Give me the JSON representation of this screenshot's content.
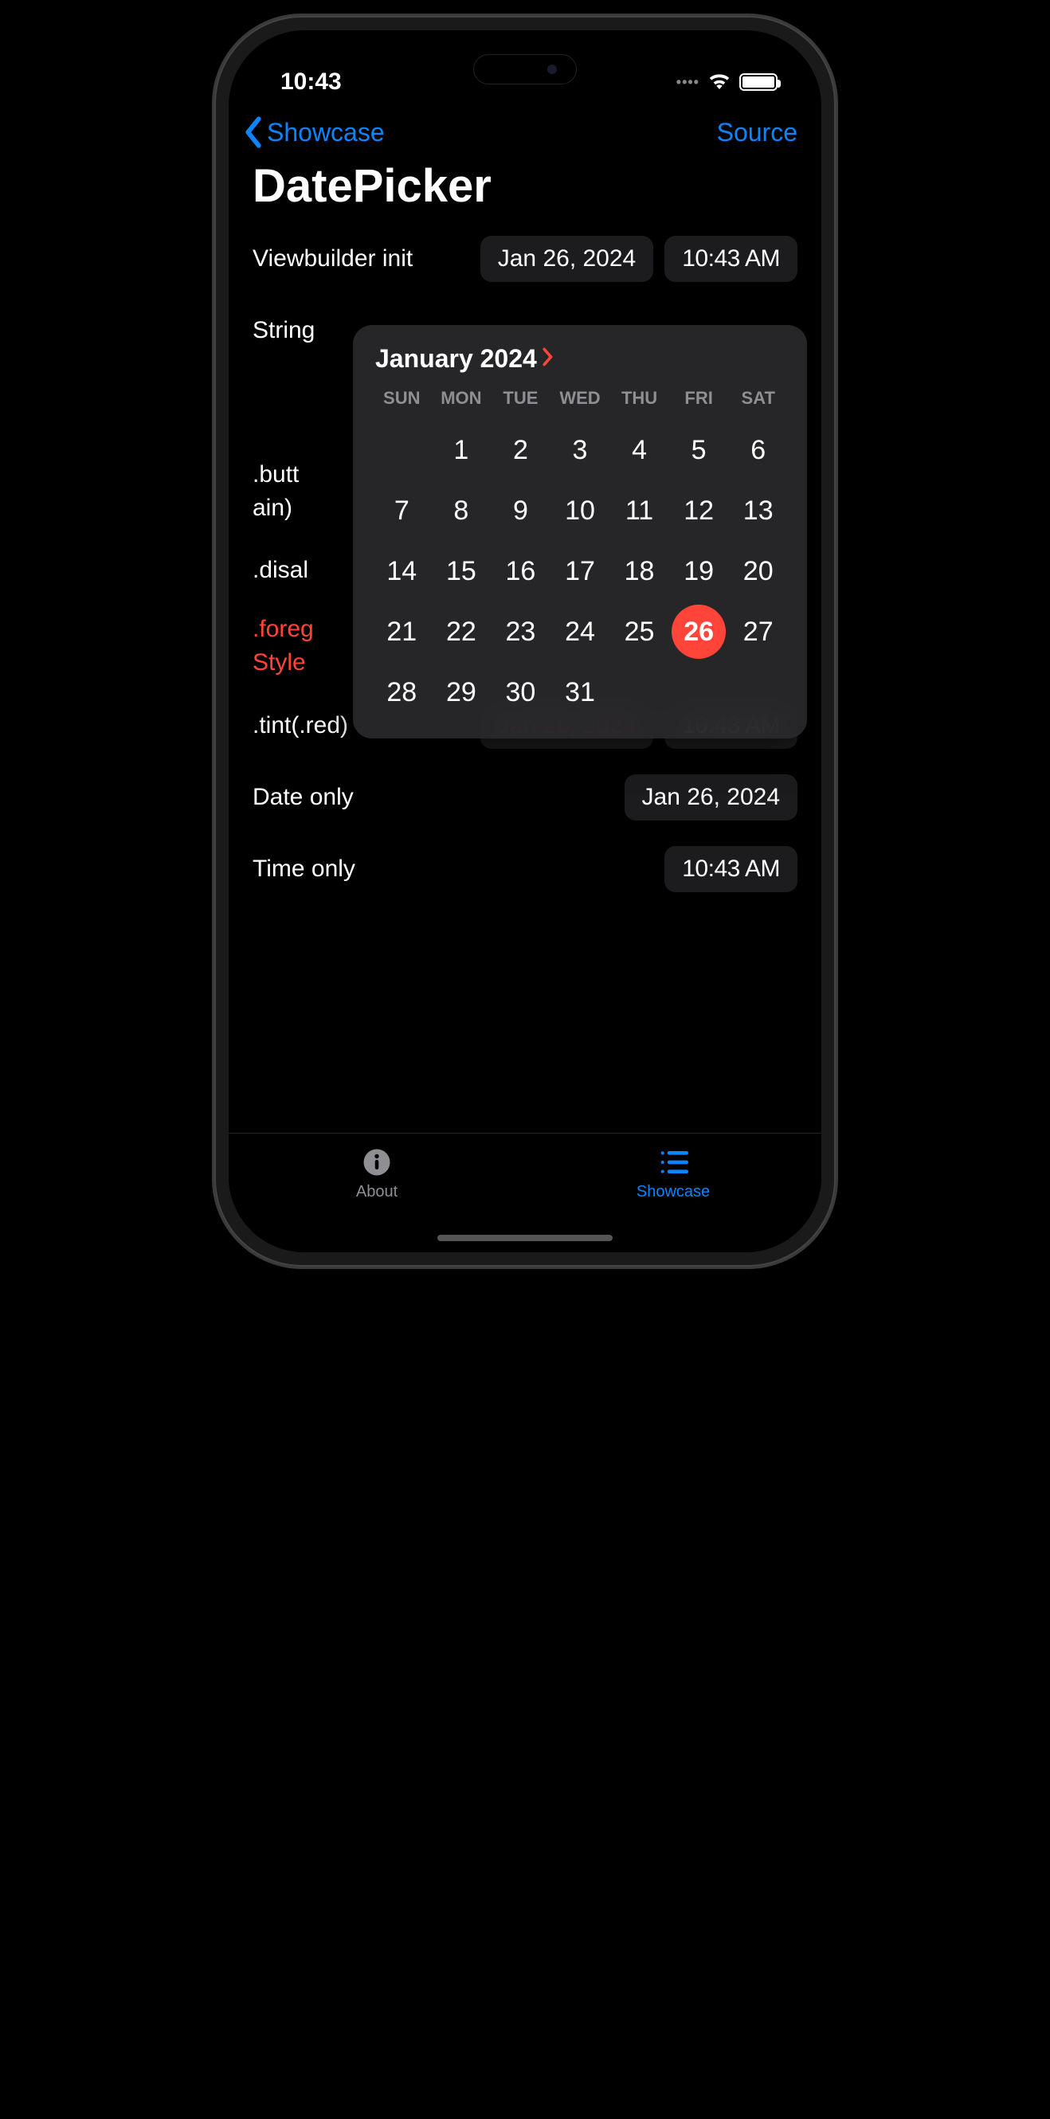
{
  "status": {
    "time": "10:43"
  },
  "nav": {
    "back_label": "Showcase",
    "source_label": "Source"
  },
  "page": {
    "title": "DatePicker"
  },
  "rows": {
    "viewbuilder": {
      "label": "Viewbuilder init",
      "date": "Jan 26, 2024",
      "time": "10:43 AM"
    },
    "string": {
      "label": "String"
    },
    "button": {
      "label_line1": ".butt",
      "label_line2": "ain)"
    },
    "disabled": {
      "label": ".disal"
    },
    "foreground": {
      "label_line1": ".foreg",
      "label_line2": "Style"
    },
    "tint": {
      "label": ".tint(.red)",
      "date": "Jan 26, 2024",
      "time": "10:43 AM"
    },
    "date_only": {
      "label": "Date only",
      "date": "Jan 26, 2024"
    },
    "time_only": {
      "label": "Time only",
      "time": "10:43 AM"
    }
  },
  "calendar": {
    "month_label": "January 2024",
    "weekdays": [
      "SUN",
      "MON",
      "TUE",
      "WED",
      "THU",
      "FRI",
      "SAT"
    ],
    "leading_blanks": 1,
    "days_in_month": 31,
    "selected_day": 26
  },
  "tabs": {
    "about": {
      "label": "About"
    },
    "showcase": {
      "label": "Showcase"
    }
  }
}
